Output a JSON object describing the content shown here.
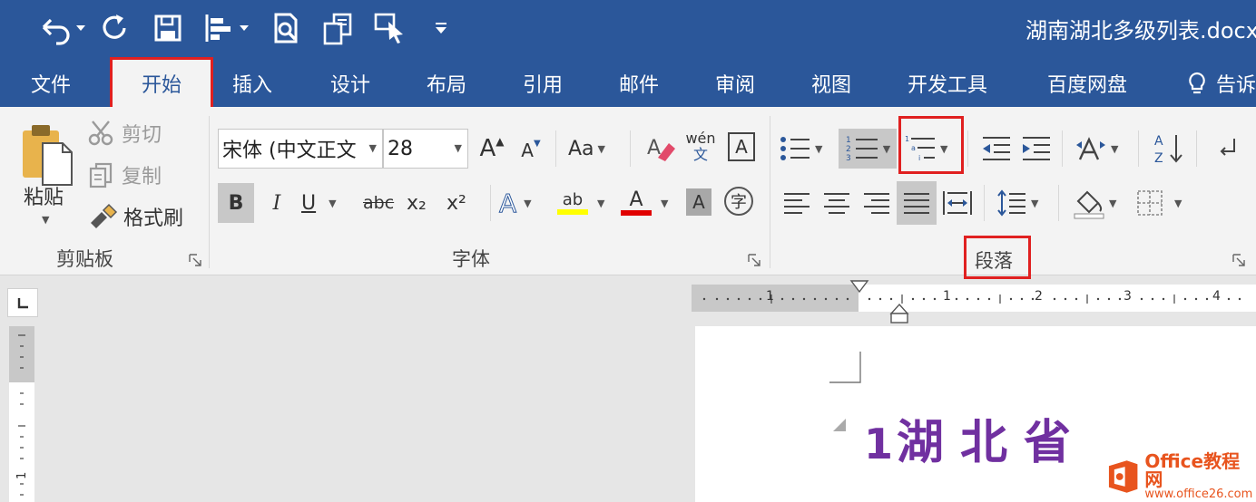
{
  "window": {
    "title": "湖南湖北多级列表.docx"
  },
  "quick_access": {
    "icons": [
      "undo-icon",
      "redo-icon",
      "save-icon",
      "align-icon",
      "print-preview-icon",
      "copy-format-icon",
      "touch-mode-icon",
      "customize-icon"
    ]
  },
  "tabs": {
    "file": "文件",
    "home": "开始",
    "insert": "插入",
    "design": "设计",
    "layout": "布局",
    "references": "引用",
    "mailings": "邮件",
    "review": "审阅",
    "view": "视图",
    "developer": "开发工具",
    "baidu": "百度网盘",
    "tell_me": "告诉"
  },
  "clipboard": {
    "paste": "粘贴",
    "cut": "剪切",
    "copy": "复制",
    "format_painter": "格式刷",
    "label": "剪贴板"
  },
  "font": {
    "family": "宋体 (中文正文",
    "size": "28",
    "label": "字体",
    "grow": "A",
    "shrink": "A",
    "change_case": "Aa",
    "bold": "B",
    "italic": "I",
    "underline": "U",
    "strikethrough": "abc",
    "subscript": "x₂",
    "superscript": "x²",
    "phonetic_top": "wén",
    "phonetic_bottom": "文",
    "char_border": "A",
    "text_effects": "A",
    "highlight": "ab",
    "font_color": "A",
    "char_shading": "A",
    "enclose": "字"
  },
  "paragraph": {
    "label": "段落"
  },
  "document": {
    "heading_number": "1",
    "heading_text": "湖北省"
  },
  "ruler": {
    "marks": [
      "1",
      "1",
      "2",
      "3",
      "4"
    ]
  },
  "watermark": {
    "line1": "Office教程网",
    "line2": "www.office26.com"
  },
  "colors": {
    "titlebar": "#2b579a",
    "ribbon": "#f3f3f3",
    "highlight_red": "#e02020",
    "heading": "#7030a0",
    "highlight_yellow": "#ffff00",
    "font_color_red": "#e00000"
  }
}
